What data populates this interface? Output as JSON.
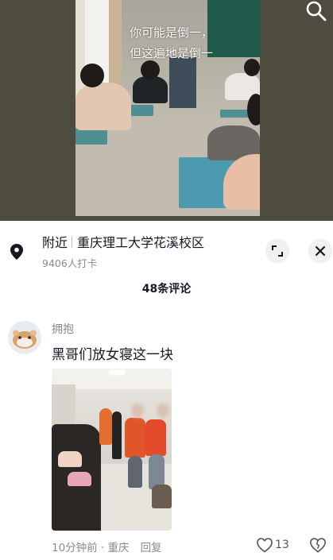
{
  "video": {
    "caption_line1": "你可能是倒一，",
    "caption_line2": "但这遍地是倒一"
  },
  "location": {
    "prefix": "附近",
    "name": "重庆理工大学花溪校区",
    "checkins": "9406人打卡"
  },
  "comments_header": "48条评论",
  "comment": {
    "user": "拥抱",
    "text": "黑哥们放女寝这一块",
    "time_location": "10分钟前 · 重庆",
    "reply_label": "回复",
    "likes": "13"
  },
  "icons": {
    "search": "search-icon",
    "location": "location-pin-icon",
    "expand": "expand-icon",
    "close": "close-icon",
    "like": "heart-icon",
    "dislike": "broken-heart-icon"
  }
}
